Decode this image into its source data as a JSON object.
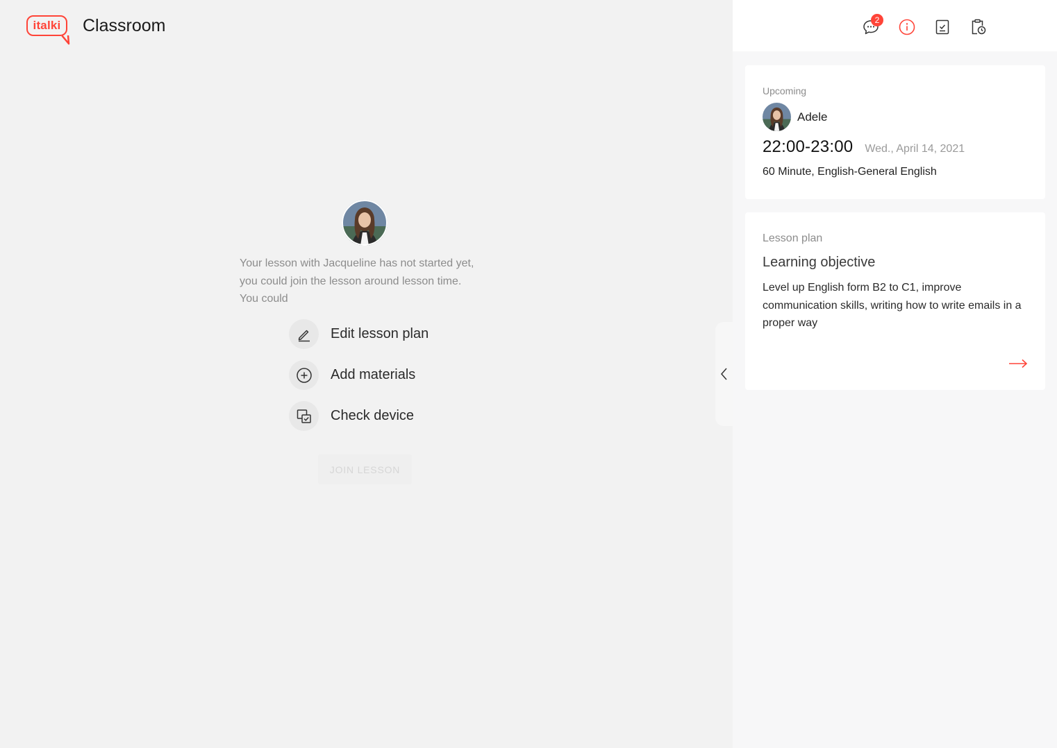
{
  "brand": {
    "logo_text": "italki",
    "app_title": "Classroom"
  },
  "colors": {
    "accent": "#ff4438",
    "main_bg": "#f2f2f2",
    "panel_bg": "#f7f7f8"
  },
  "main": {
    "notice": "Your lesson with Jacqueline has not started yet, you could join the lesson around lesson time. You could",
    "actions": [
      {
        "label": "Edit lesson plan",
        "icon": "pencil-icon"
      },
      {
        "label": "Add materials",
        "icon": "plus-circle-icon"
      },
      {
        "label": "Check device",
        "icon": "device-check-icon"
      }
    ],
    "join_button": "JOIN LESSON"
  },
  "panel": {
    "toolbar": {
      "chat_badge_count": "2",
      "icons": [
        "chat-icon",
        "info-icon",
        "notes-icon",
        "clipboard-icon"
      ]
    },
    "upcoming": {
      "label": "Upcoming",
      "teacher_name": "Adele",
      "time": "22:00-23:00",
      "date": "Wed., April 14, 2021",
      "detail": "60 Minute, English-General English"
    },
    "lesson_plan": {
      "label": "Lesson plan",
      "title": "Learning objective",
      "text": "Level up English form B2 to C1, improve communication skills, writing how to write emails in a proper way"
    }
  }
}
